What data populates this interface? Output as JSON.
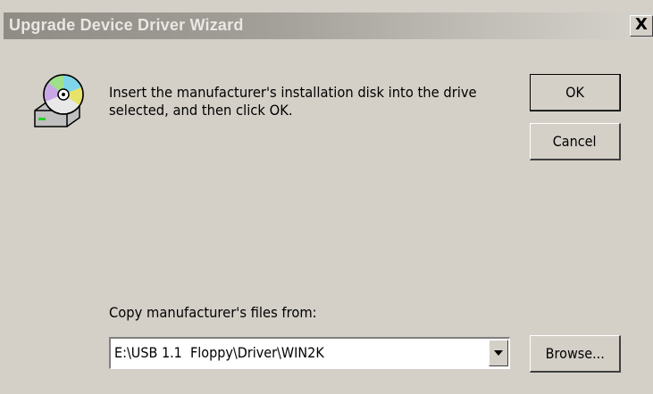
{
  "window": {
    "title": "Upgrade Device Driver Wizard",
    "close_label": "X"
  },
  "dialog": {
    "icon": "disk-drive-icon",
    "message_line1": "Insert the manufacturer's installation disk into the drive",
    "message_line2": "selected, and then click OK.",
    "ok_label": "OK",
    "cancel_label": "Cancel",
    "copy_label": "Copy manufacturer's files from:",
    "path_value": "E:\\USB 1.1  Floppy\\Driver\\WIN2K",
    "browse_label": "Browse..."
  },
  "colors": {
    "dialog_bg": "#d4d0c8",
    "title_text": "#e9e7e3"
  }
}
